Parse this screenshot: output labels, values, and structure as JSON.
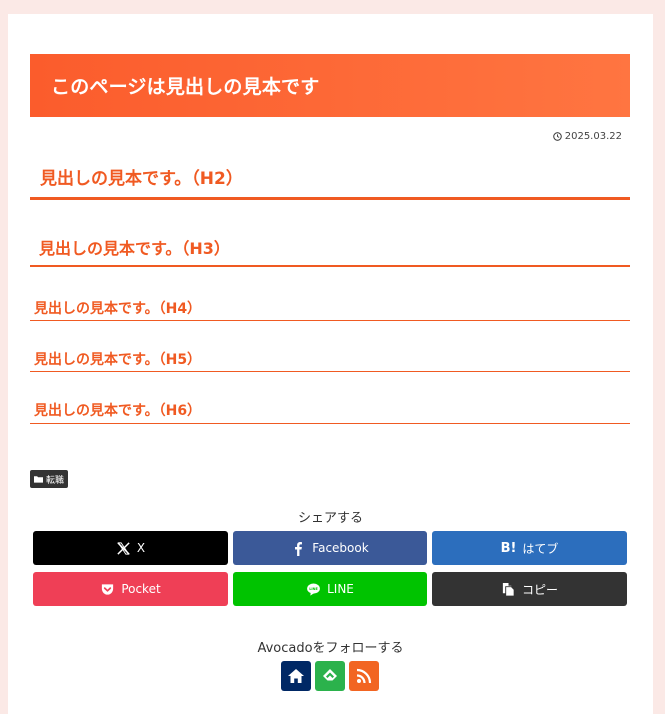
{
  "page": {
    "title": "このページは見出しの見本です",
    "date": "2025.03.22"
  },
  "headings": {
    "h2": "見出しの見本です。（H2）",
    "h3": "見出しの見本です。（H3）",
    "h4": "見出しの見本です。（H4）",
    "h5": "見出しの見本です。（H5）",
    "h6": "見出しの見本です。（H6）"
  },
  "category_tag": {
    "label": "転職",
    "icon": "folder-icon"
  },
  "share": {
    "heading": "シェアする",
    "buttons": [
      {
        "label": "X",
        "icon": "x-icon",
        "color": "#000000"
      },
      {
        "label": "Facebook",
        "icon": "facebook-icon",
        "color": "#3b5998"
      },
      {
        "label": "はてブ",
        "icon": "hatena-bookmark-icon",
        "color": "#2c6ebd"
      },
      {
        "label": "Pocket",
        "icon": "pocket-icon",
        "color": "#ef3f56"
      },
      {
        "label": "LINE",
        "icon": "line-icon",
        "color": "#00c300"
      },
      {
        "label": "コピー",
        "icon": "copy-icon",
        "color": "#333333"
      }
    ]
  },
  "follow": {
    "heading": "Avocadoをフォローする",
    "buttons": [
      {
        "icon": "home-icon",
        "color": "#002865"
      },
      {
        "icon": "feedly-icon",
        "color": "#2bb24c"
      },
      {
        "icon": "rss-icon",
        "color": "#f26522"
      }
    ]
  },
  "colors": {
    "accent": "#f05a22",
    "page_background": "#fbe9e6"
  }
}
